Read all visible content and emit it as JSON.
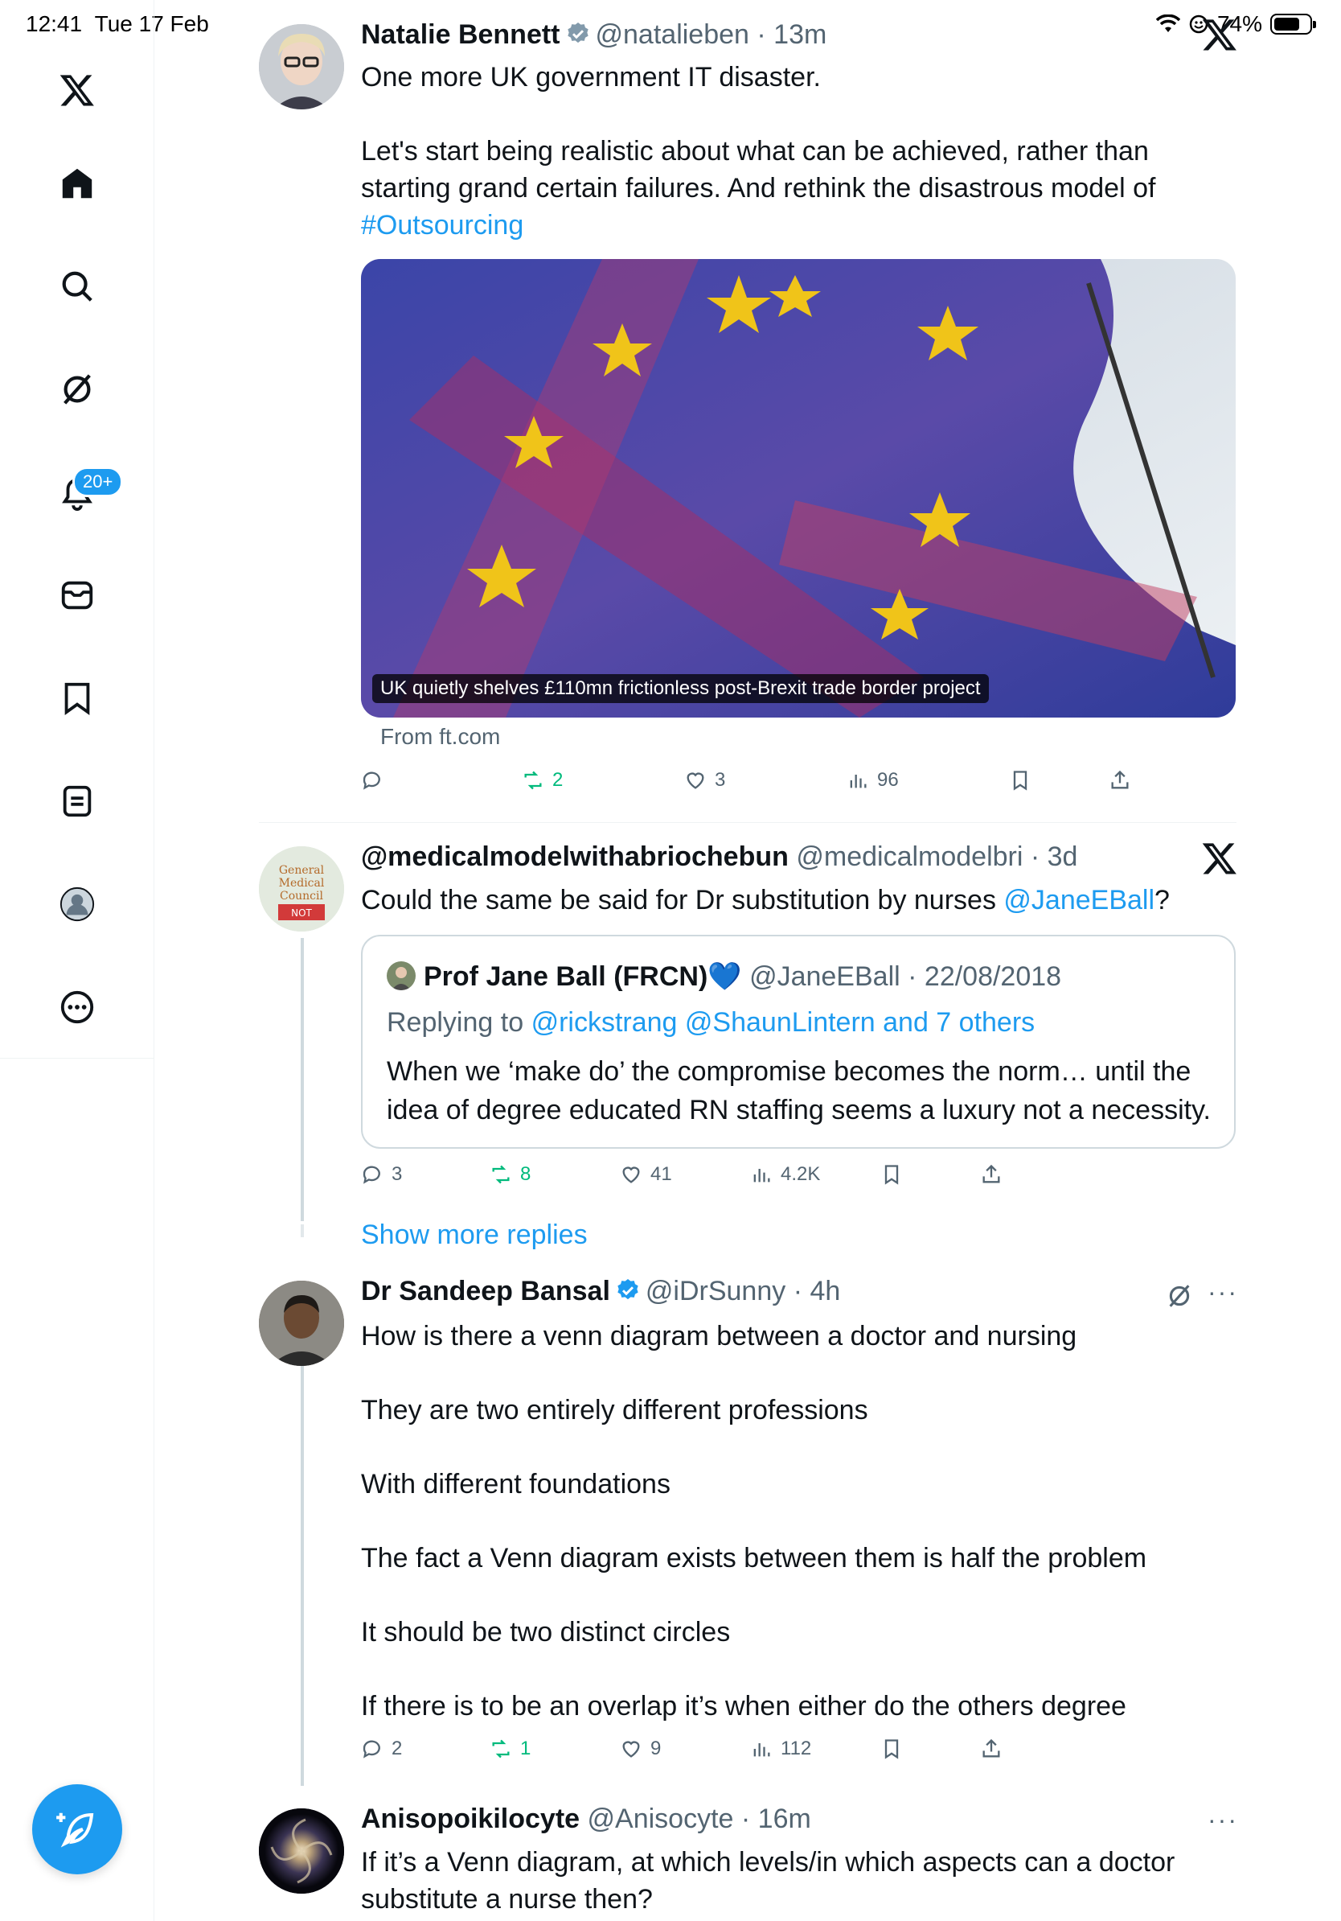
{
  "status_bar": {
    "time": "12:41",
    "date": "Tue 17 Feb",
    "battery": "74%",
    "battery_level": 0.74
  },
  "sidebar": {
    "items": [
      {
        "icon": "x-logo-icon"
      },
      {
        "icon": "home-icon"
      },
      {
        "icon": "search-icon"
      },
      {
        "icon": "grok-icon"
      },
      {
        "icon": "notifications-icon"
      },
      {
        "icon": "messages-icon"
      },
      {
        "icon": "bookmarks-icon"
      },
      {
        "icon": "lists-icon"
      },
      {
        "icon": "profile-icon"
      },
      {
        "icon": "more-icon"
      }
    ],
    "notifications_badge": "20+"
  },
  "tweets": [
    {
      "name": "Natalie Bennett",
      "handle": "@natalieben",
      "time": "13m",
      "lines": [
        "One more UK government IT disaster.",
        "",
        "Let's start being realistic about what can be achieved, rather than",
        "starting grand certain failures. And rethink the disastrous model of"
      ],
      "hashtag": "#Outsourcing",
      "card_caption": "UK quietly shelves £110mn frictionless post-Brexit trade border project",
      "card_from": "From ft.com",
      "replies": "",
      "reposts": "2",
      "likes": "3",
      "views": "96"
    },
    {
      "name": "@medicalmodelwithabriochebun",
      "handle": "@medicalmodelbri",
      "time": "3d",
      "text": "Could the same be said for Dr substitution by nurses",
      "mention": "@JaneEBall",
      "text_end": "?",
      "quote": {
        "name": "Prof Jane Ball (FRCN)",
        "emoji": "💙",
        "handle": "@JaneEBall",
        "time": "22/08/2018",
        "replying_label": "Replying to",
        "replying_to": "@rickstrang @ShaunLintern and 7 others",
        "lines": [
          "When we ‘make do’ the compromise becomes the norm… until the",
          "idea of degree educated RN staffing seems a luxury not a necessity."
        ]
      },
      "replies": "3",
      "reposts": "8",
      "likes": "41",
      "views": "4.2K"
    },
    {
      "name": "Dr Sandeep Bansal",
      "handle": "@iDrSunny",
      "time": "4h",
      "lines": [
        "How is there a venn diagram between a doctor and nursing",
        "They are two entirely different professions",
        "With different foundations",
        "The fact a Venn diagram exists between them is half the problem",
        "It should be two distinct circles",
        "If there is to be an overlap it’s when either do the others degree"
      ],
      "replies": "2",
      "reposts": "1",
      "likes": "9",
      "views": "112"
    },
    {
      "name": "Anisopoikilocyte",
      "handle": "@Anisocyte",
      "time": "16m",
      "lines": [
        "If it’s a Venn diagram, at which levels/in which aspects can a doctor",
        "substitute a nurse then?"
      ]
    }
  ],
  "show_more": "Show more replies",
  "colors": {
    "accent": "#1d9bf0",
    "repost": "#00ba7c",
    "muted": "#536471"
  }
}
